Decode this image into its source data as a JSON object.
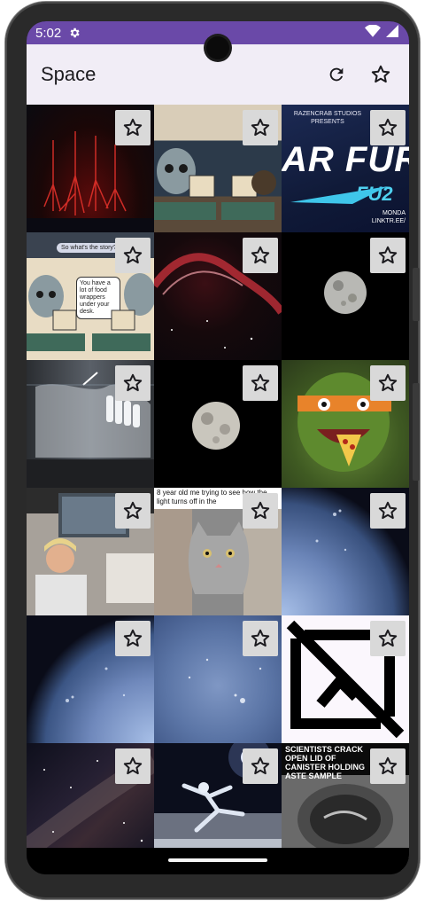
{
  "status": {
    "time": "5:02"
  },
  "appbar": {
    "title": "Space",
    "actions": [
      {
        "icon": "refresh-icon"
      },
      {
        "icon": "star-outline-icon"
      }
    ]
  },
  "grid": {
    "items": [
      {
        "id": "red-sprites",
        "favorite": false
      },
      {
        "id": "comic-aliens-desk",
        "favorite": false
      },
      {
        "id": "star-fury-promo",
        "text": "AR FUR",
        "sub": "FU2",
        "small": "RAZENCRAB STUDIOS PRESENTS",
        "footer": "MONDA LINKTR.EE/",
        "favorite": false
      },
      {
        "id": "comic-food-wrappers",
        "bubble1": "So what's the story?",
        "bubble2": "You have a lot of food wrappers under your desk.",
        "favorite": false
      },
      {
        "id": "veil-nebula",
        "favorite": false
      },
      {
        "id": "moon-1",
        "favorite": false
      },
      {
        "id": "dental-xray",
        "favorite": false
      },
      {
        "id": "moon-2",
        "favorite": false
      },
      {
        "id": "ninja-turtle-pizza",
        "favorite": false
      },
      {
        "id": "person-photo",
        "favorite": false
      },
      {
        "id": "cat-meme",
        "caption": "8 year old me trying to see how the light turns off in the",
        "favorite": false
      },
      {
        "id": "sun-surface-1",
        "favorite": false
      },
      {
        "id": "sun-surface-2",
        "favorite": false
      },
      {
        "id": "sun-surface-3",
        "favorite": false
      },
      {
        "id": "broken-image",
        "favorite": false
      },
      {
        "id": "milky-way",
        "favorite": false
      },
      {
        "id": "astronaut-dancer",
        "favorite": false
      },
      {
        "id": "canister-news",
        "headline": "SCIENTISTS CRACK OPEN LID OF CANISTER HOLDING ASTE SAMPLE",
        "favorite": false
      }
    ]
  },
  "colors": {
    "status_bar": "#6a49a8",
    "app_bar": "#f1edf6",
    "star_button": "#d9d9d9"
  }
}
